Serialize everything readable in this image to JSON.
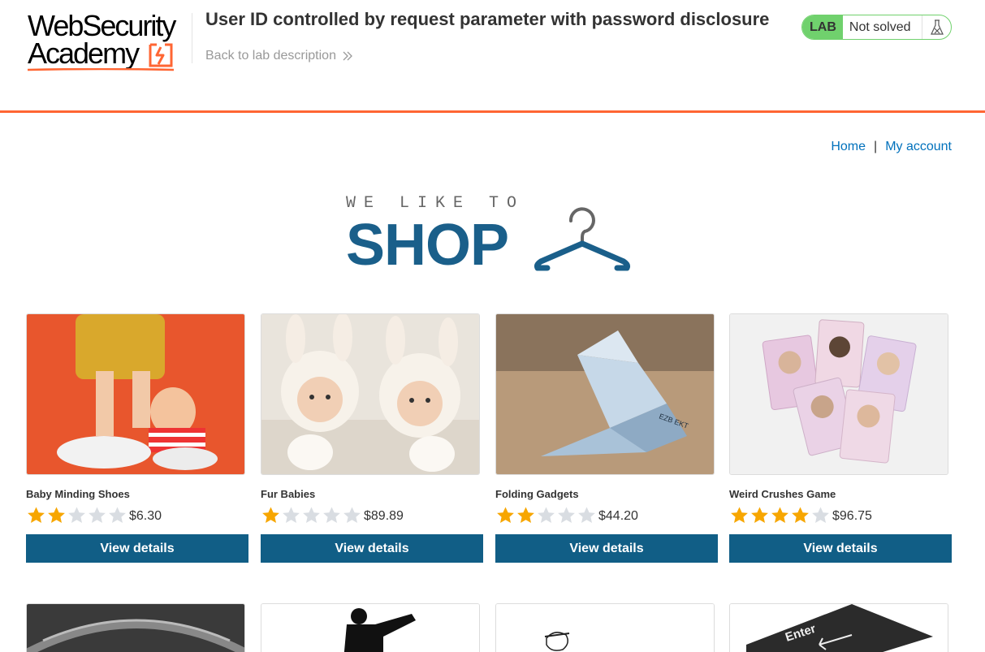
{
  "academy": {
    "logo_line1": "WebSecurity",
    "logo_line2": "Academy",
    "lab_title": "User ID controlled by request parameter with password disclosure",
    "back_link": "Back to lab description",
    "status_badge": "LAB",
    "status_text": "Not solved"
  },
  "nav": {
    "home": "Home",
    "separator": "|",
    "my_account": "My account"
  },
  "banner": {
    "small_text": "WE LIKE TO",
    "big_text": "SHOP"
  },
  "colors": {
    "accent_orange": "#ff6633",
    "lab_green": "#70d16d",
    "link_blue": "#0071bc",
    "button_blue": "#115e86",
    "banner_blue": "#1a5f8a",
    "star_gold": "#f7a600",
    "star_empty": "#d9dde2"
  },
  "products": [
    {
      "name": "Baby Minding Shoes",
      "rating": 2,
      "max_rating": 5,
      "price": "$6.30",
      "button": "View details"
    },
    {
      "name": "Fur Babies",
      "rating": 1,
      "max_rating": 5,
      "price": "$89.89",
      "button": "View details"
    },
    {
      "name": "Folding Gadgets",
      "rating": 2,
      "max_rating": 5,
      "price": "$44.20",
      "button": "View details"
    },
    {
      "name": "Weird Crushes Game",
      "rating": 4,
      "max_rating": 5,
      "price": "$96.75",
      "button": "View details"
    }
  ],
  "row2_keys": [
    "Enter"
  ]
}
